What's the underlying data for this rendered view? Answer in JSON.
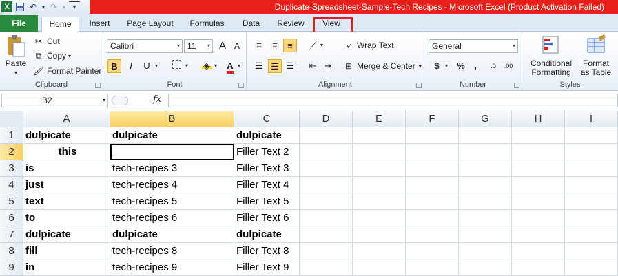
{
  "window": {
    "title": "Duplicate-Spreadsheet-Sample-Tech Recipes  -  Microsoft Excel (Product Activation Failed)"
  },
  "quick_access": [
    {
      "name": "excel-icon",
      "glyph": "X"
    },
    {
      "name": "save-icon",
      "glyph": "💾"
    },
    {
      "name": "undo-icon",
      "glyph": "↶"
    },
    {
      "name": "redo-icon",
      "glyph": "↷"
    },
    {
      "name": "customize-qat-icon",
      "glyph": "▾"
    }
  ],
  "tabs": [
    "File",
    "Home",
    "Insert",
    "Page Layout",
    "Formulas",
    "Data",
    "Review",
    "View"
  ],
  "ribbon": {
    "clipboard": {
      "label": "Clipboard",
      "paste": "Paste",
      "cut": "Cut",
      "copy": "Copy",
      "format_painter": "Format Painter"
    },
    "font": {
      "label": "Font",
      "font_name": "Calibri",
      "font_size": "11",
      "grow": "A",
      "shrink": "A",
      "bold": "B",
      "italic": "I",
      "underline": "U",
      "font_color": "A"
    },
    "alignment": {
      "label": "Alignment",
      "wrap_text": "Wrap Text",
      "merge_center": "Merge & Center"
    },
    "number": {
      "label": "Number",
      "format": "General",
      "currency": "$",
      "percent": "%",
      "comma": ","
    },
    "styles": {
      "label": "Styles",
      "conditional": [
        "Conditional",
        "Formatting"
      ],
      "format_table": [
        "Format",
        "as Table"
      ]
    }
  },
  "formula_bar": {
    "name_box": "B2",
    "fx": "fx",
    "value": ""
  },
  "columns": [
    "A",
    "B",
    "C",
    "D",
    "E",
    "F",
    "G",
    "H",
    "I"
  ],
  "selected_column": "B",
  "rows": [
    {
      "num": "1",
      "cells": [
        "dulpicate",
        "dulpicate",
        "dulpicate"
      ],
      "bold": [
        true,
        true,
        true
      ]
    },
    {
      "num": "2",
      "cells": [
        "this",
        "",
        "Filler Text 2"
      ],
      "bold": [
        true,
        false,
        false
      ]
    },
    {
      "num": "3",
      "cells": [
        "is",
        "tech-recipes  3",
        "Filler Text 3"
      ],
      "bold": [
        true,
        false,
        false
      ]
    },
    {
      "num": "4",
      "cells": [
        "just",
        "tech-recipes 4",
        "Filler Text 4"
      ],
      "bold": [
        true,
        false,
        false
      ]
    },
    {
      "num": "5",
      "cells": [
        "text",
        "tech-recipes  5",
        "Filler Text 5"
      ],
      "bold": [
        true,
        false,
        false
      ]
    },
    {
      "num": "6",
      "cells": [
        "to",
        "tech-recipes  6",
        "Filler Text 6"
      ],
      "bold": [
        true,
        false,
        false
      ]
    },
    {
      "num": "7",
      "cells": [
        "dulpicate",
        "dulpicate",
        "dulpicate"
      ],
      "bold": [
        true,
        true,
        true
      ]
    },
    {
      "num": "8",
      "cells": [
        "fill",
        "tech-recipes  8",
        "Filler Text 8"
      ],
      "bold": [
        true,
        false,
        false
      ]
    },
    {
      "num": "9",
      "cells": [
        "in",
        "tech-recipes 9",
        "Filler Text 9"
      ],
      "bold": [
        true,
        false,
        false
      ]
    }
  ],
  "selected_row": "2",
  "colors": {
    "title_red": "#e8201b",
    "file_tab_green": "#2a8a3e",
    "highlight_box": "#e0201b",
    "selection_header": "#f9cf5f"
  }
}
